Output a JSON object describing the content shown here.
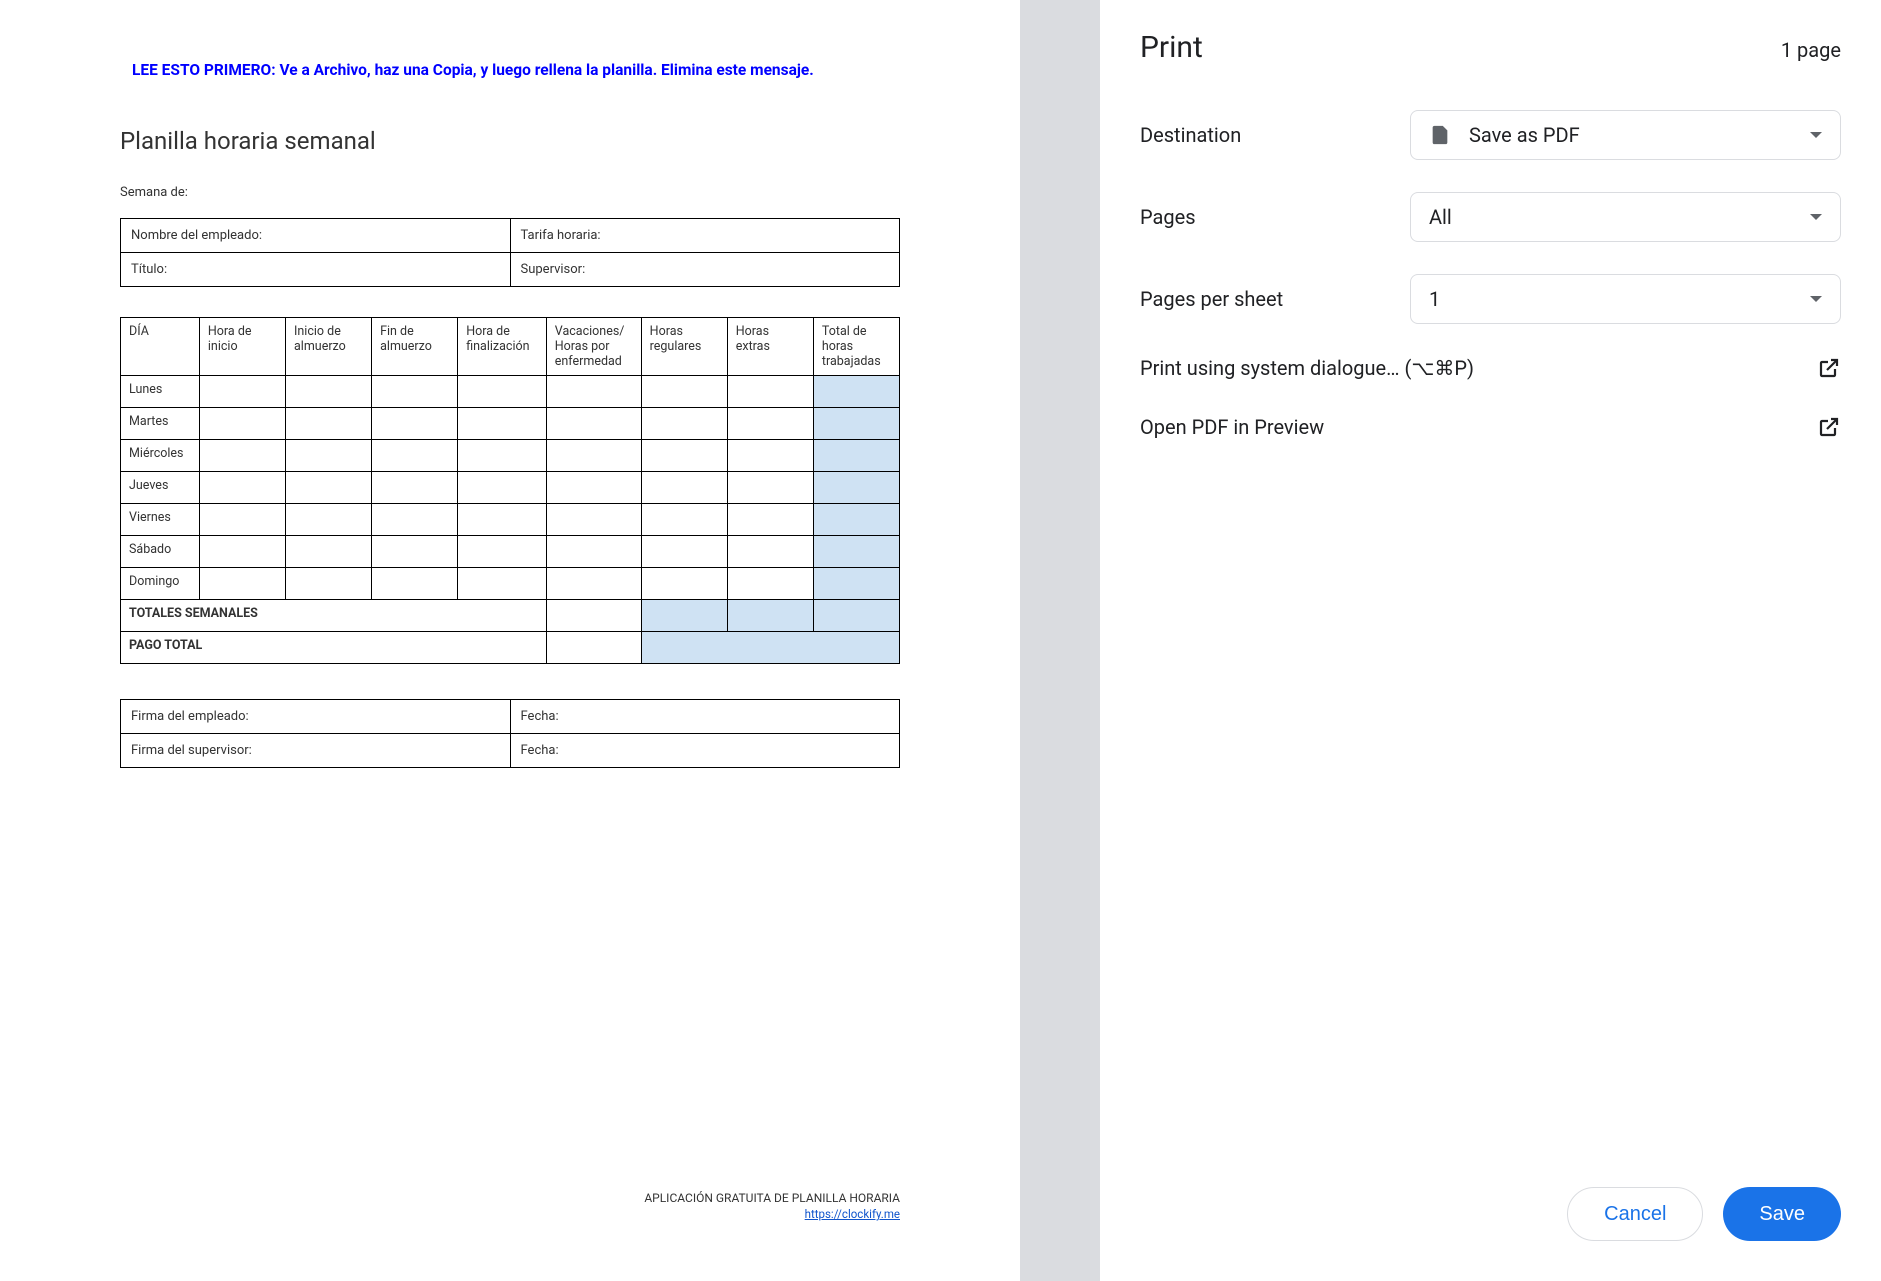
{
  "preview": {
    "warning": "LEE ESTO PRIMERO: Ve a Archivo, haz una Copia, y luego rellena la planilla. Elimina este mensaje.",
    "title": "Planilla horaria semanal",
    "week_label": "Semana de:",
    "info_table": {
      "employee_name": "Nombre del empleado:",
      "hourly_rate": "Tarifa horaria:",
      "job_title": "Título:",
      "supervisor": "Supervisor:"
    },
    "hours_table": {
      "headers": [
        "DÍA",
        "Hora de inicio",
        "Inicio de almuerzo",
        "Fin de almuerzo",
        "Hora de finalización",
        "Vacaciones/ Horas por enfermedad",
        "Horas regulares",
        "Horas extras",
        "Total de horas trabajadas"
      ],
      "days": [
        "Lunes",
        "Martes",
        "Miércoles",
        "Jueves",
        "Viernes",
        "Sábado",
        "Domingo"
      ],
      "totals_row": "TOTALES SEMANALES",
      "pay_row": "PAGO TOTAL"
    },
    "sign_table": {
      "employee_sig": "Firma del empleado:",
      "date1": "Fecha:",
      "supervisor_sig": "Firma del supervisor:",
      "date2": "Fecha:"
    },
    "footer": "APLICACIÓN GRATUITA DE PLANILLA HORARIA",
    "footer_link": "https://clockify.me"
  },
  "panel": {
    "title": "Print",
    "page_count": "1 page",
    "destination": {
      "label": "Destination",
      "value": "Save as PDF"
    },
    "pages": {
      "label": "Pages",
      "value": "All"
    },
    "pages_per_sheet": {
      "label": "Pages per sheet",
      "value": "1"
    },
    "system_dialog": "Print using system dialogue… (⌥⌘P)",
    "open_preview": "Open PDF in Preview",
    "cancel": "Cancel",
    "save": "Save"
  }
}
